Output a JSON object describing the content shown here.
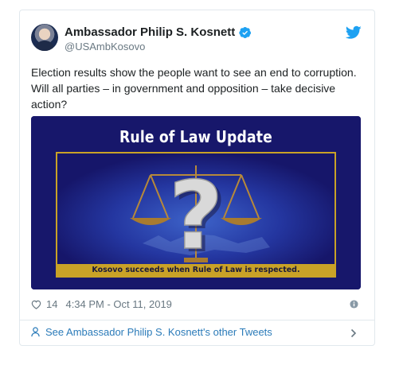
{
  "tweet": {
    "author_name": "Ambassador Philip S. Kosnett",
    "handle": "@USAmbKosovo",
    "text": "Election results show the people want to see an end to corruption.   Will all parties – in government and opposition – take decisive action?",
    "likes": "14",
    "timestamp": "4:34 PM - Oct 11, 2019",
    "see_more": "See Ambassador Philip S. Kosnett's other Tweets"
  },
  "media": {
    "title": "Rule of Law Update",
    "caption": "Kosovo succeeds when Rule of Law is respected."
  },
  "icons": [
    "verified-badge-icon",
    "twitter-bird-icon",
    "heart-icon",
    "info-icon",
    "user-icon",
    "chevron-right-icon"
  ],
  "colors": {
    "accent": "#1da1f2",
    "link": "#2b7bb9",
    "muted": "#697882",
    "media_bg": "#1a1a6c",
    "gold": "#c9a227"
  }
}
